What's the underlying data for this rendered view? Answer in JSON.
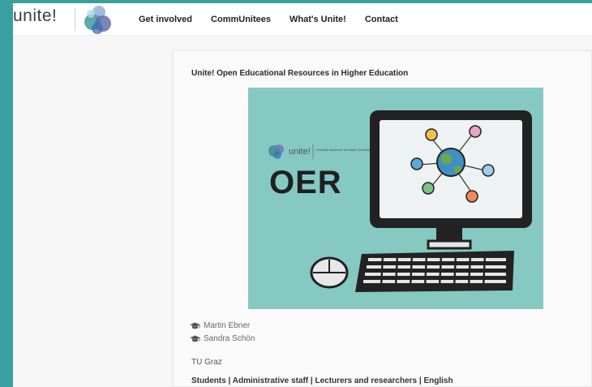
{
  "header": {
    "logo_text": "unite!",
    "nav": [
      "Get involved",
      "CommUnitees",
      "What's Unite!",
      "Contact"
    ]
  },
  "resource": {
    "title": "Unite! Open Educational Resources in Higher Education",
    "thumbnail": {
      "logo_text": "unite!",
      "logo_subtext": "University Network for Innovation, Technology and Engineering",
      "heading": "OER"
    },
    "authors": [
      "Martin Ebner",
      "Sandra Schön"
    ],
    "institution": "TU Graz",
    "tags": "Students | Administrative staff | Lecturers and researchers | English"
  },
  "colors": {
    "frame": "#3b9f9f",
    "thumbnail_bg": "#86c8c2"
  },
  "icons": [
    "unite-logo-icon",
    "graduation-cap-icon"
  ]
}
